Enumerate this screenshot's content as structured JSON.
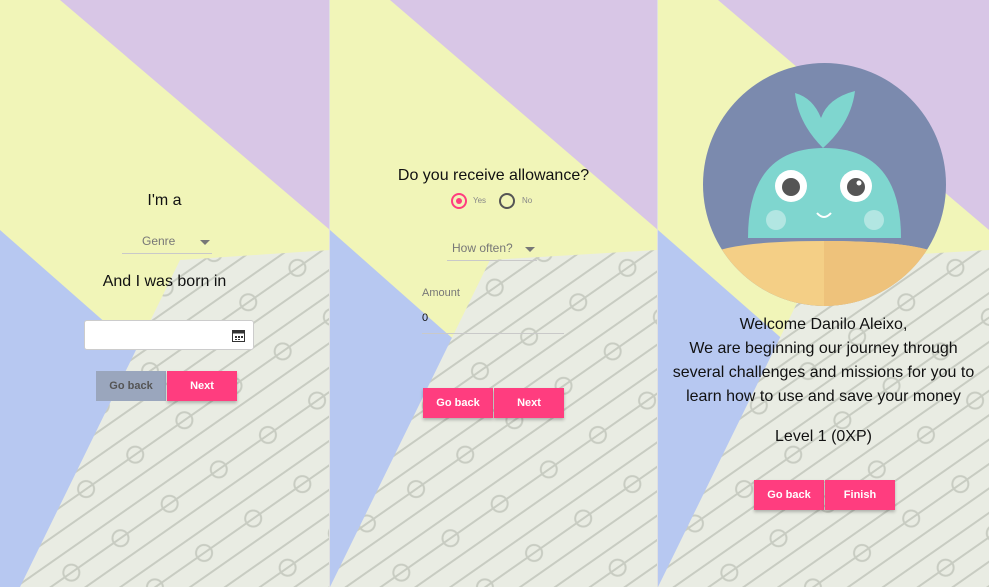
{
  "screen1": {
    "heading": "I'm a",
    "genre_select": "Genre",
    "born_label": "And I was born in",
    "date_value": "",
    "back_label": "Go back",
    "next_label": "Next"
  },
  "screen2": {
    "question": "Do you receive allowance?",
    "radio_yes": "Yes",
    "radio_no": "No",
    "selected": "Yes",
    "frequency_select": "How often?",
    "amount_label": "Amount",
    "amount_value": "0",
    "back_label": "Go back",
    "next_label": "Next"
  },
  "screen3": {
    "welcome": "Welcome Danilo Aleixo,",
    "line1": "We are beginning our journey through",
    "line2": "several challenges and missions for you to",
    "line3": "learn how to use and save your money",
    "level": "Level 1 (0XP)",
    "back_label": "Go back",
    "finish_label": "Finish"
  },
  "colors": {
    "accent": "#ff3d7f",
    "disabled": "#9aa6bd",
    "mascot_body": "#7fd6cf",
    "avatar_bg": "#7b8aae"
  }
}
